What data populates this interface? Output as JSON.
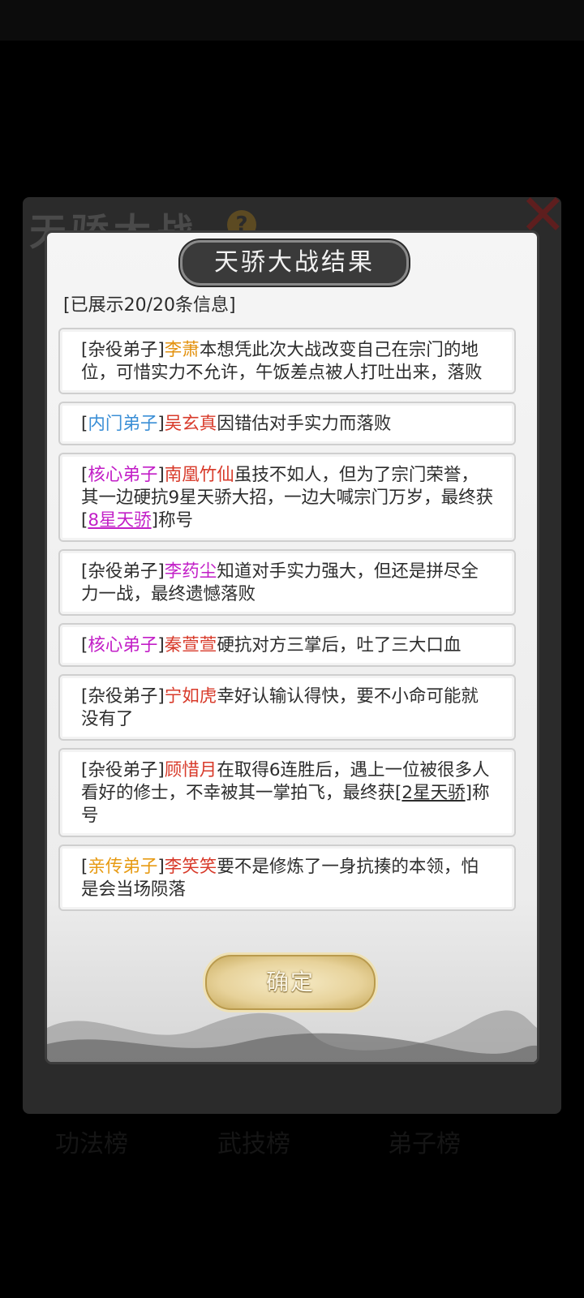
{
  "background": {
    "panel_title": "天骄大战",
    "help_icon": "question-mark-icon",
    "close_icon": "close-x-icon",
    "bottom_tabs": [
      "功法榜",
      "武技榜",
      "弟子榜"
    ]
  },
  "modal": {
    "title": "天骄大战结果",
    "info_count": "[已展示20/20条信息]",
    "confirm_label": "确定"
  },
  "entries": [
    {
      "rank": "杂役弟子",
      "rank_color": "gray",
      "name": "李萧",
      "name_color": "orange",
      "text": "本想凭此次大战改变自己在宗门的地位，可惜实力不允许，午饭差点被人打吐出来，落败",
      "title": "",
      "suffix": ""
    },
    {
      "rank": "内门弟子",
      "rank_color": "blue",
      "name": "吴玄真",
      "name_color": "red",
      "text": "因错估对手实力而落败",
      "title": "",
      "suffix": ""
    },
    {
      "rank": "核心弟子",
      "rank_color": "purple",
      "name": "南凰竹仙",
      "name_color": "red",
      "text": "虽技不如人，但为了宗门荣誉，其一边硬抗9星天骄大招，一边大喊宗门万岁，最终获",
      "title": "8星天骄",
      "title_color": "purple",
      "suffix": "称号"
    },
    {
      "rank": "杂役弟子",
      "rank_color": "gray",
      "name": "李药尘",
      "name_color": "purple",
      "text": "知道对手实力强大，但还是拼尽全力一战，最终遗憾落败",
      "title": "",
      "suffix": ""
    },
    {
      "rank": "核心弟子",
      "rank_color": "purple",
      "name": "秦萱萱",
      "name_color": "red",
      "text": "硬抗对方三掌后，吐了三大口血",
      "title": "",
      "suffix": ""
    },
    {
      "rank": "杂役弟子",
      "rank_color": "gray",
      "name": "宁如虎",
      "name_color": "red",
      "text": "幸好认输认得快，要不小命可能就没有了",
      "title": "",
      "suffix": ""
    },
    {
      "rank": "杂役弟子",
      "rank_color": "gray",
      "name": "顾惜月",
      "name_color": "red",
      "text": "在取得6连胜后，遇上一位被很多人看好的修士，不幸被其一掌拍飞，最终获",
      "title": "2星天骄",
      "title_color": "dark",
      "suffix": "称号"
    },
    {
      "rank": "亲传弟子",
      "rank_color": "orange",
      "name": "李笑笑",
      "name_color": "red",
      "text": "要不是修炼了一身抗揍的本领，怕是会当场陨落",
      "title": "",
      "suffix": ""
    }
  ]
}
